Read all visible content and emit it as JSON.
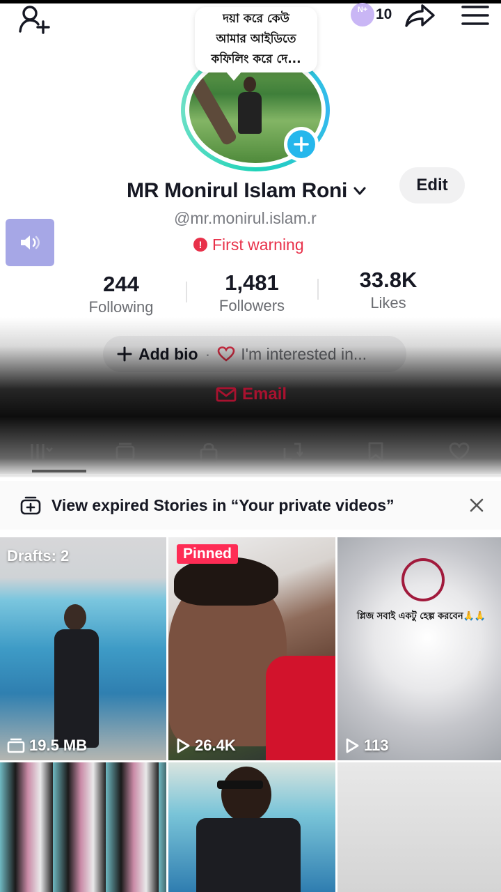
{
  "header": {
    "notification_badge": "N+",
    "notification_count": "10",
    "icons": [
      "add-friend-icon",
      "share-icon",
      "menu-icon"
    ]
  },
  "profile": {
    "speech_bubble_lines": [
      "দয়া করে কেউ",
      "আমার আইডিতে",
      "কফিলিং করে দে..."
    ],
    "name": "MR Monirul Islam Roni",
    "edit_label": "Edit",
    "handle": "@mr.monirul.islam.r",
    "warning": "First warning",
    "stats": [
      {
        "value": "244",
        "label": "Following"
      },
      {
        "value": "1,481",
        "label": "Followers"
      },
      {
        "value": "33.8K",
        "label": "Likes"
      }
    ],
    "add_bio": "Add bio",
    "bio_separator": "·",
    "interested": "I'm interested in...",
    "email": "Email"
  },
  "tabs": [
    "videos-tab",
    "stories-tab",
    "private-tab",
    "reposts-tab",
    "favorites-tab",
    "liked-tab"
  ],
  "banner": {
    "text": "View expired Stories in “Your private videos”"
  },
  "grid": {
    "items": [
      {
        "badge": "Drafts: 2",
        "meta": "19.5 MB"
      },
      {
        "badge": "Pinned",
        "meta": "26.4K"
      },
      {
        "caption": "প্লিজ সবাই একটু হেল্প করবেন🙏🙏",
        "meta": "113"
      },
      {},
      {},
      {}
    ]
  },
  "colors": {
    "accent": "#fe2c55",
    "warning": "#e8314a",
    "ring": "#1fd3b8",
    "plus": "#25b7ec",
    "sound": "#a6a7e6"
  }
}
